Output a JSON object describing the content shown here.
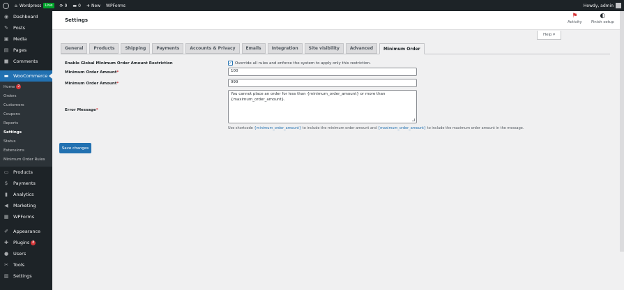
{
  "adminbar": {
    "site_name": "Wordpress",
    "live_badge": "Live",
    "updates_count": "9",
    "comments_count": "0",
    "new_label": "New",
    "wpforms_label": "WPForms",
    "howdy": "Howdy, admin"
  },
  "sidebar": {
    "items_top": [
      {
        "label": "Dashboard",
        "icon": "dashboard-icon",
        "glyph": "◉"
      },
      {
        "label": "Posts",
        "icon": "posts-pin-icon",
        "glyph": "✎"
      },
      {
        "label": "Media",
        "icon": "media-icon",
        "glyph": "▣"
      },
      {
        "label": "Pages",
        "icon": "pages-icon",
        "glyph": "▤"
      },
      {
        "label": "Comments",
        "icon": "comments-icon",
        "glyph": "■"
      }
    ],
    "woocommerce": {
      "label": "WooCommerce",
      "icon": "woocommerce-icon",
      "glyph": "▬"
    },
    "submenu": [
      {
        "label": "Home",
        "badge": "2"
      },
      {
        "label": "Orders"
      },
      {
        "label": "Customers"
      },
      {
        "label": "Coupons"
      },
      {
        "label": "Reports"
      },
      {
        "label": "Settings",
        "current": true
      },
      {
        "label": "Status"
      },
      {
        "label": "Extensions"
      },
      {
        "label": "Minimum Order Rules"
      }
    ],
    "items_mid": [
      {
        "label": "Products",
        "icon": "products-icon",
        "glyph": "▭"
      },
      {
        "label": "Payments",
        "icon": "payments-icon",
        "glyph": "$"
      },
      {
        "label": "Analytics",
        "icon": "analytics-icon",
        "glyph": "▮"
      },
      {
        "label": "Marketing",
        "icon": "marketing-icon",
        "glyph": "◀"
      },
      {
        "label": "WPForms",
        "icon": "wpforms-icon",
        "glyph": "▦"
      }
    ],
    "items_bottom": [
      {
        "label": "Appearance",
        "icon": "appearance-icon",
        "glyph": "✐"
      },
      {
        "label": "Plugins",
        "icon": "plugins-icon",
        "glyph": "✚",
        "badge": "8"
      },
      {
        "label": "Users",
        "icon": "users-icon",
        "glyph": "●"
      },
      {
        "label": "Tools",
        "icon": "tools-icon",
        "glyph": "✂"
      },
      {
        "label": "Settings",
        "icon": "settings-icon",
        "glyph": "▥"
      }
    ]
  },
  "header": {
    "title": "Settings",
    "activity_label": "Activity",
    "finish_setup_label": "Finish setup",
    "help_label": "Help ▾"
  },
  "tabs": [
    {
      "label": "General"
    },
    {
      "label": "Products"
    },
    {
      "label": "Shipping"
    },
    {
      "label": "Payments"
    },
    {
      "label": "Accounts & Privacy"
    },
    {
      "label": "Emails"
    },
    {
      "label": "Integration"
    },
    {
      "label": "Site visibility"
    },
    {
      "label": "Advanced"
    },
    {
      "label": "Minimum Order",
      "active": true
    }
  ],
  "form": {
    "enable_label": "Enable Global Minimum Order Amount Restriction",
    "enable_checkbox_text": "Override all rules and enforce the system to apply only this restriction.",
    "enable_checked": true,
    "min_label": "Minimum Order Amount",
    "min_value": "100",
    "max_label": "Minimum Order Amount",
    "max_value": "999",
    "required_mark": "*",
    "error_label": "Error Message",
    "error_value": "You cannot place an order for less than {minimum_order_amount} or more than {maximum_order_amount}.",
    "help_prefix": "Use shortcode ",
    "help_code_min": "{minimum_order_amount}",
    "help_mid": " to include the minimum order amount and ",
    "help_code_max": "{maximum_order_amount}",
    "help_suffix": " to include the maximum order amount in the message."
  },
  "save_button": "Save changes",
  "colors": {
    "accent": "#2271b1",
    "sidebar_bg": "#1d2327",
    "badge": "#d63638",
    "live": "#00a32a"
  }
}
